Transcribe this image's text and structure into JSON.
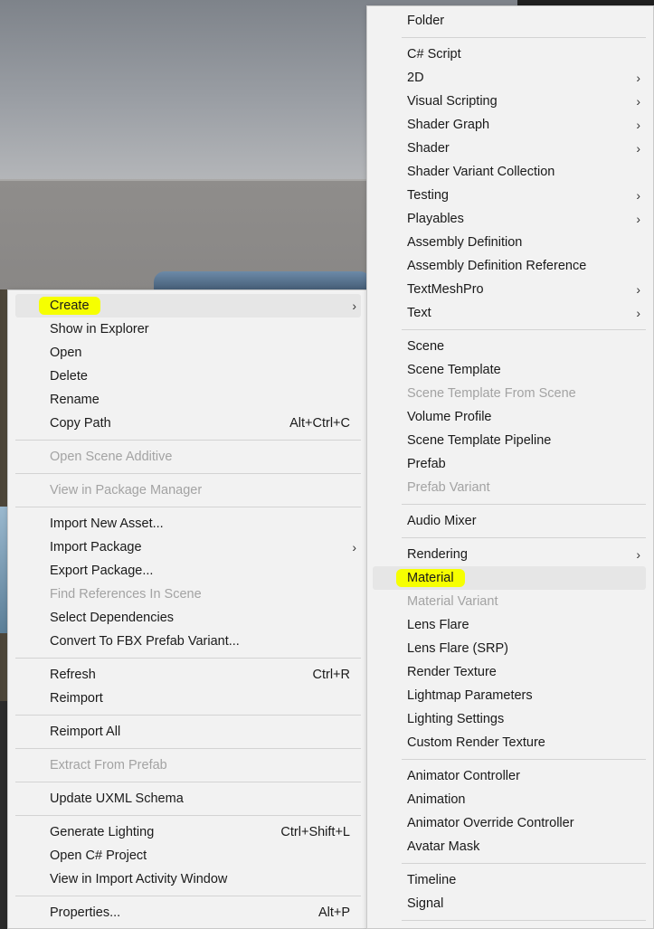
{
  "left_menu": {
    "items": [
      {
        "label": "Create",
        "submenu": true,
        "highlighted": true
      },
      {
        "label": "Show in Explorer"
      },
      {
        "label": "Open"
      },
      {
        "label": "Delete"
      },
      {
        "label": "Rename"
      },
      {
        "label": "Copy Path",
        "shortcut": "Alt+Ctrl+C"
      },
      {
        "label": "Open Scene Additive",
        "disabled": true
      },
      {
        "label": "View in Package Manager",
        "disabled": true
      },
      {
        "label": "Import New Asset..."
      },
      {
        "label": "Import Package",
        "submenu": true
      },
      {
        "label": "Export Package..."
      },
      {
        "label": "Find References In Scene",
        "disabled": true
      },
      {
        "label": "Select Dependencies"
      },
      {
        "label": "Convert To FBX Prefab Variant..."
      },
      {
        "label": "Refresh",
        "shortcut": "Ctrl+R"
      },
      {
        "label": "Reimport"
      },
      {
        "label": "Reimport All"
      },
      {
        "label": "Extract From Prefab",
        "disabled": true
      },
      {
        "label": "Update UXML Schema"
      },
      {
        "label": "Generate Lighting",
        "shortcut": "Ctrl+Shift+L"
      },
      {
        "label": "Open C# Project"
      },
      {
        "label": "View in Import Activity Window"
      },
      {
        "label": "Properties...",
        "shortcut": "Alt+P"
      }
    ],
    "submenu_arrow": "›"
  },
  "right_menu": {
    "items": [
      {
        "label": "Folder"
      },
      {
        "label": "C# Script"
      },
      {
        "label": "2D",
        "submenu": true
      },
      {
        "label": "Visual Scripting",
        "submenu": true
      },
      {
        "label": "Shader Graph",
        "submenu": true
      },
      {
        "label": "Shader",
        "submenu": true
      },
      {
        "label": "Shader Variant Collection"
      },
      {
        "label": "Testing",
        "submenu": true
      },
      {
        "label": "Playables",
        "submenu": true
      },
      {
        "label": "Assembly Definition"
      },
      {
        "label": "Assembly Definition Reference"
      },
      {
        "label": "TextMeshPro",
        "submenu": true
      },
      {
        "label": "Text",
        "submenu": true
      },
      {
        "label": "Scene"
      },
      {
        "label": "Scene Template"
      },
      {
        "label": "Scene Template From Scene",
        "disabled": true
      },
      {
        "label": "Volume Profile"
      },
      {
        "label": "Scene Template Pipeline"
      },
      {
        "label": "Prefab"
      },
      {
        "label": "Prefab Variant",
        "disabled": true
      },
      {
        "label": "Audio Mixer"
      },
      {
        "label": "Rendering",
        "submenu": true
      },
      {
        "label": "Material",
        "highlighted": true
      },
      {
        "label": "Material Variant",
        "disabled": true
      },
      {
        "label": "Lens Flare"
      },
      {
        "label": "Lens Flare (SRP)"
      },
      {
        "label": "Render Texture"
      },
      {
        "label": "Lightmap Parameters"
      },
      {
        "label": "Lighting Settings"
      },
      {
        "label": "Custom Render Texture"
      },
      {
        "label": "Animator Controller"
      },
      {
        "label": "Animation"
      },
      {
        "label": "Animator Override Controller"
      },
      {
        "label": "Avatar Mask"
      },
      {
        "label": "Timeline"
      },
      {
        "label": "Signal"
      }
    ]
  },
  "colors": {
    "menu_bg": "#f2f2f2",
    "hover_bg": "#e6e6e6",
    "highlight": "#f6ff00",
    "disabled": "#a3a3a3"
  }
}
